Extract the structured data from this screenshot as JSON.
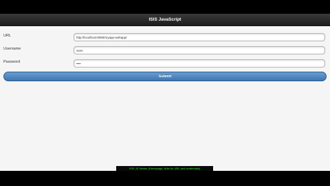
{
  "app": {
    "title": "ISIS JavaScript"
  },
  "form": {
    "url_label": "URL",
    "url_value": "http://localhost:8080/myapp-webapp/",
    "username_label": "Username",
    "username_value": "sven",
    "password_label": "Password",
    "password_value": "pass",
    "submit_label": "Submit"
  },
  "caption": {
    "text": "ISIS JS Viewer (Homepage, links for URL and credentials)"
  },
  "colors": {
    "titlebar": "#2a2a2a",
    "button": "#4f86c0",
    "background": "#f5f5f5",
    "caption_text": "#39e639"
  }
}
